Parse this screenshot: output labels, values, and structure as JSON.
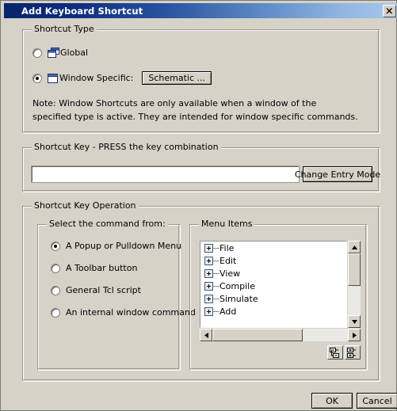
{
  "window": {
    "title": "Add Keyboard Shortcut",
    "close_icon": "close-x-icon",
    "bg_color": "#d6d2c8",
    "titlebar_start_color": "#0a246a",
    "titlebar_end_color": "#a8c9ee"
  },
  "shortcut_type": {
    "group_title": "Shortcut Type",
    "options": [
      {
        "label": "Global",
        "selected": false,
        "icon": "multi-window-icon"
      },
      {
        "label": "Window Specific:",
        "selected": true,
        "icon": "single-window-icon"
      }
    ],
    "window_type_button": "Schematic ...",
    "note": "Note: Window Shortcuts are only available when a window of the\nspecified type is active. They are intended for window specific commands."
  },
  "shortcut_key": {
    "group_title": "Shortcut Key - PRESS the key combination",
    "input_value": "",
    "input_placeholder": "",
    "change_entry_mode_button": "Change Entry Mode"
  },
  "shortcut_key_operation": {
    "group_title": "Shortcut Key Operation",
    "command_source": {
      "group_title": "Select the command from:",
      "options": [
        {
          "label": "A Popup or Pulldown Menu",
          "selected": true
        },
        {
          "label": "A Toolbar button",
          "selected": false
        },
        {
          "label": "General Tcl script",
          "selected": false
        },
        {
          "label": "An internal window command",
          "selected": false
        }
      ]
    },
    "menu_items": {
      "group_title": "Menu Items",
      "nodes": [
        {
          "label": "File",
          "expanded": false
        },
        {
          "label": "Edit",
          "expanded": false
        },
        {
          "label": "View",
          "expanded": false
        },
        {
          "label": "Compile",
          "expanded": false
        },
        {
          "label": "Simulate",
          "expanded": false
        },
        {
          "label": "Add",
          "expanded": false
        }
      ],
      "tools": [
        {
          "name": "collapse-all-icon"
        },
        {
          "name": "expand-all-icon"
        }
      ]
    }
  },
  "footer": {
    "ok_label": "OK",
    "cancel_label": "Cancel"
  }
}
